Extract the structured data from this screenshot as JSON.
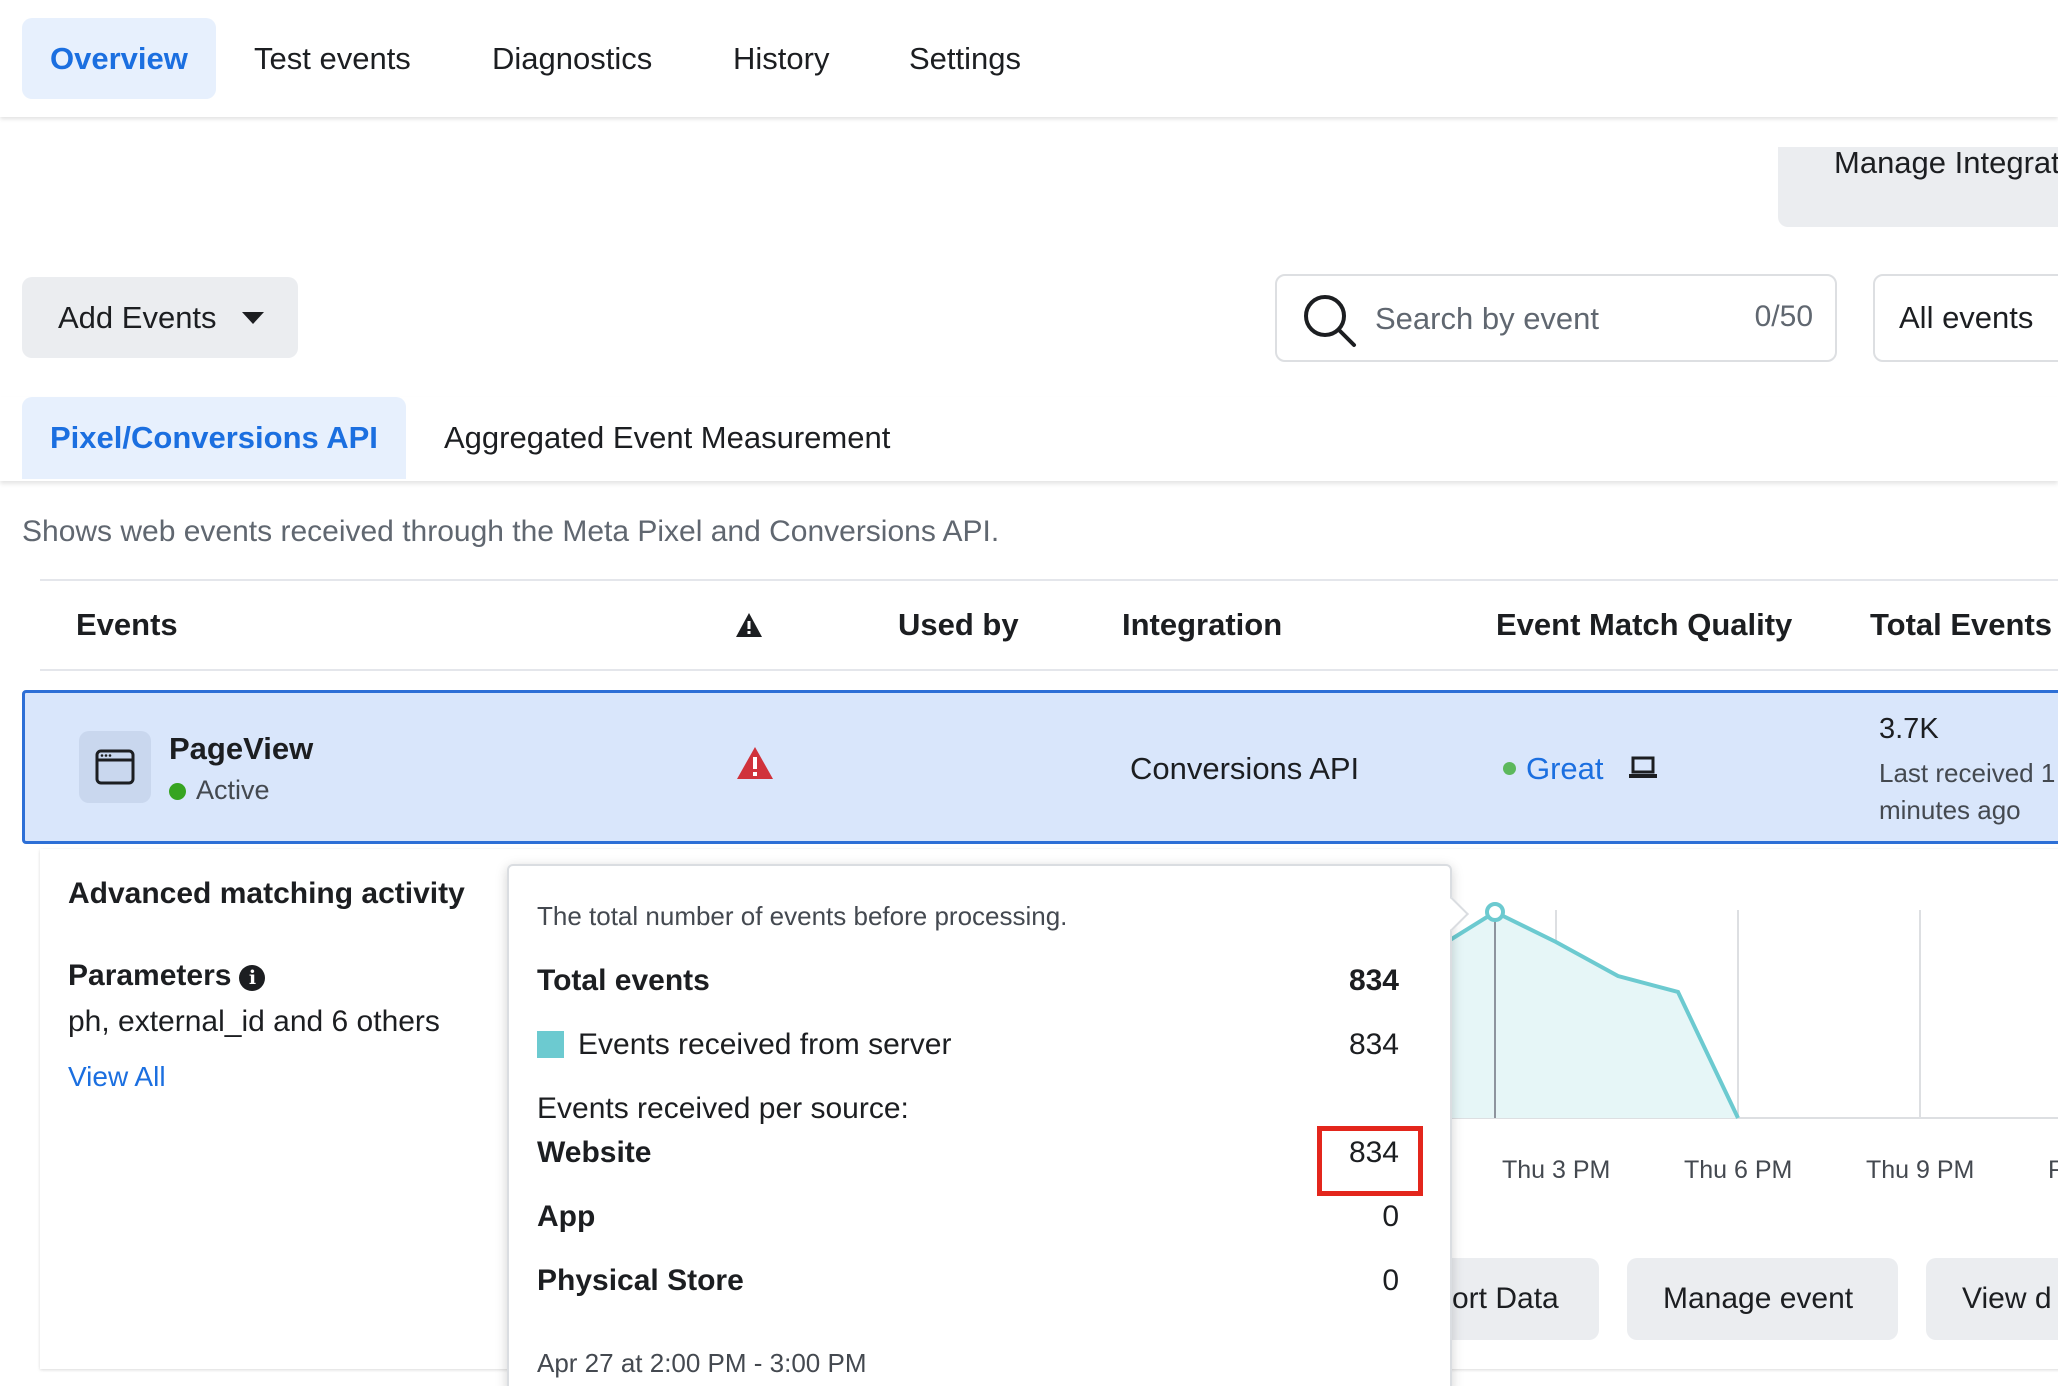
{
  "nav": {
    "tabs": [
      {
        "label": "Overview",
        "active": true
      },
      {
        "label": "Test events",
        "active": false
      },
      {
        "label": "Diagnostics",
        "active": false
      },
      {
        "label": "History",
        "active": false
      },
      {
        "label": "Settings",
        "active": false
      }
    ]
  },
  "toolbar": {
    "manage_integrations_label": "Manage Integrat",
    "add_events_label": "Add Events",
    "search_placeholder": "Search by event",
    "search_count": "0/50",
    "filter_label": "All events"
  },
  "subtabs": [
    {
      "label": "Pixel/Conversions API",
      "active": true
    },
    {
      "label": "Aggregated Event Measurement",
      "active": false
    }
  ],
  "description": "Shows web events received through the Meta Pixel and Conversions API.",
  "table": {
    "headers": {
      "events": "Events",
      "used_by": "Used by",
      "integration": "Integration",
      "emq": "Event Match Quality",
      "total": "Total Events"
    },
    "row": {
      "name": "PageView",
      "status": "Active",
      "integration": "Conversions API",
      "emq": "Great",
      "total": "3.7K",
      "last_received": "Last received 1 minutes ago"
    }
  },
  "detail": {
    "title": "Advanced matching activity",
    "parameters_label": "Parameters",
    "parameters_value": "ph, external_id and 6 others",
    "view_all": "View All",
    "chart_ticks": [
      "Thu 3 PM",
      "Thu 6 PM",
      "Thu 9 PM",
      "F"
    ],
    "buttons": [
      "ort Data",
      "Manage event",
      "View d"
    ]
  },
  "tooltip": {
    "note": "The total number of events before processing.",
    "total_label": "Total events",
    "total_value": "834",
    "server_label": "Events received from server",
    "server_value": "834",
    "per_source_label": "Events received per source:",
    "website_label": "Website",
    "website_value": "834",
    "app_label": "App",
    "app_value": "0",
    "store_label": "Physical Store",
    "store_value": "0",
    "date_range": "Apr 27 at 2:00 PM - 3:00 PM"
  },
  "colors": {
    "accent": "#1b6fe0",
    "active_tab_bg": "#e7f0fd",
    "selected_row_bg": "#d9e6fb",
    "warning": "#d0323b",
    "status_green": "#36a420",
    "chart_line": "#6ccad0",
    "highlight": "#e3261c"
  }
}
